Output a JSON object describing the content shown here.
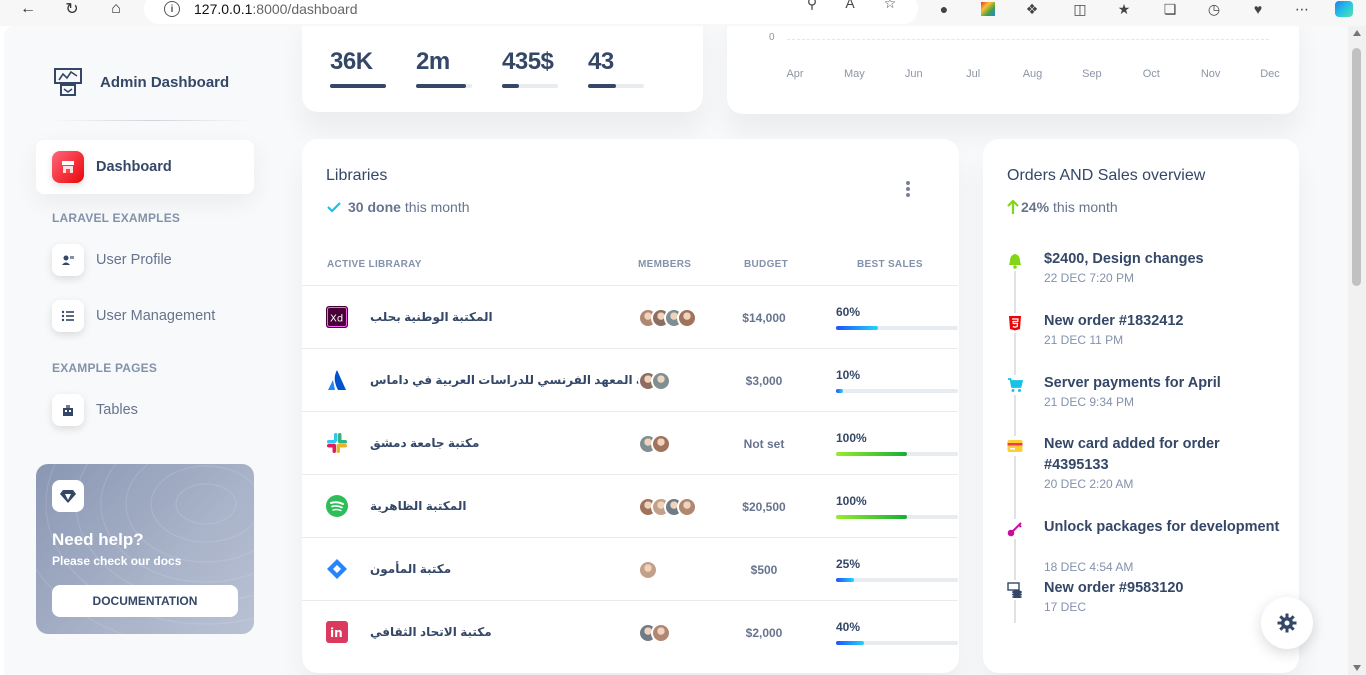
{
  "browser": {
    "url_host": "127.0.0.1",
    "url_path": ":8000/dashboard"
  },
  "sidebar": {
    "brand": "Admin Dashboard",
    "items": [
      {
        "label": "Dashboard",
        "active": true
      },
      {
        "label": "User Profile"
      },
      {
        "label": "User Management"
      },
      {
        "label": "Tables"
      }
    ],
    "sections": [
      "LARAVEL EXAMPLES",
      "EXAMPLE PAGES"
    ],
    "help": {
      "title": "Need help?",
      "subtitle": "Please check our docs",
      "button": "DOCUMENTATION"
    }
  },
  "stats": [
    {
      "value": "36K",
      "progress": 1.0
    },
    {
      "value": "2m",
      "progress": 0.9
    },
    {
      "value": "435$",
      "progress": 0.3
    },
    {
      "value": "43",
      "progress": 0.5
    }
  ],
  "chart_data": {
    "type": "line",
    "categories": [
      "Apr",
      "May",
      "Jun",
      "Jul",
      "Aug",
      "Sep",
      "Oct",
      "Nov",
      "Dec"
    ],
    "y_tick_visible": "0"
  },
  "libraries": {
    "title": "Libraries",
    "done_count": "30 done",
    "done_suffix": "this month",
    "headers": [
      "ACTIVE LIBRARAY",
      "MEMBERS",
      "BUDGET",
      "BEST SALES"
    ],
    "rows": [
      {
        "name": "المكتبة الوطنية بحلب",
        "logo": "adobe-xd-logo",
        "members": 4,
        "budget": "$14,000",
        "completion": "60%",
        "value": 60
      },
      {
        "name": "مكتبة المعهد الفرنسي للدراسات العربية في داماس",
        "logo": "atlassian-logo",
        "members": 2,
        "budget": "$3,000",
        "completion": "10%",
        "value": 10
      },
      {
        "name": "مكتبة جامعة دمشق",
        "logo": "slack-logo",
        "members": 2,
        "budget": "Not set",
        "completion": "100%",
        "value": 100
      },
      {
        "name": "المكتبة الظاهرية",
        "logo": "spotify-logo",
        "members": 4,
        "budget": "$20,500",
        "completion": "100%",
        "value": 100
      },
      {
        "name": "مكتبة المأمون",
        "logo": "jira-logo",
        "members": 1,
        "budget": "$500",
        "completion": "25%",
        "value": 25
      },
      {
        "name": "مكتبة الاتحاد الثقافي",
        "logo": "invision-logo",
        "members": 2,
        "budget": "$2,000",
        "completion": "40%",
        "value": 40
      }
    ]
  },
  "orders": {
    "title": "Orders AND Sales overview",
    "growth": "24%",
    "growth_suffix": "this month",
    "items": [
      {
        "title": "$2400, Design changes",
        "date": "22 DEC 7:20 PM",
        "icon": "bell-icon",
        "color": "#82d616"
      },
      {
        "title": "New order #1832412",
        "date": "21 DEC 11 PM",
        "icon": "html5-icon",
        "color": "#ea0606"
      },
      {
        "title": "Server payments for April",
        "date": "21 DEC 9:34 PM",
        "icon": "cart-icon",
        "color": "#17c1e8"
      },
      {
        "title": "New card added for order #4395133",
        "date": "20 DEC 2:20 AM",
        "icon": "credit-card-icon",
        "color": "#fbcf33"
      },
      {
        "title": "Unlock packages for development",
        "date": "18 DEC 4:54 AM",
        "icon": "key-icon",
        "color": "#cb0c9f"
      },
      {
        "title": "New order #9583120",
        "date": "17 DEC",
        "icon": "money-icon",
        "color": "#344767"
      }
    ]
  }
}
